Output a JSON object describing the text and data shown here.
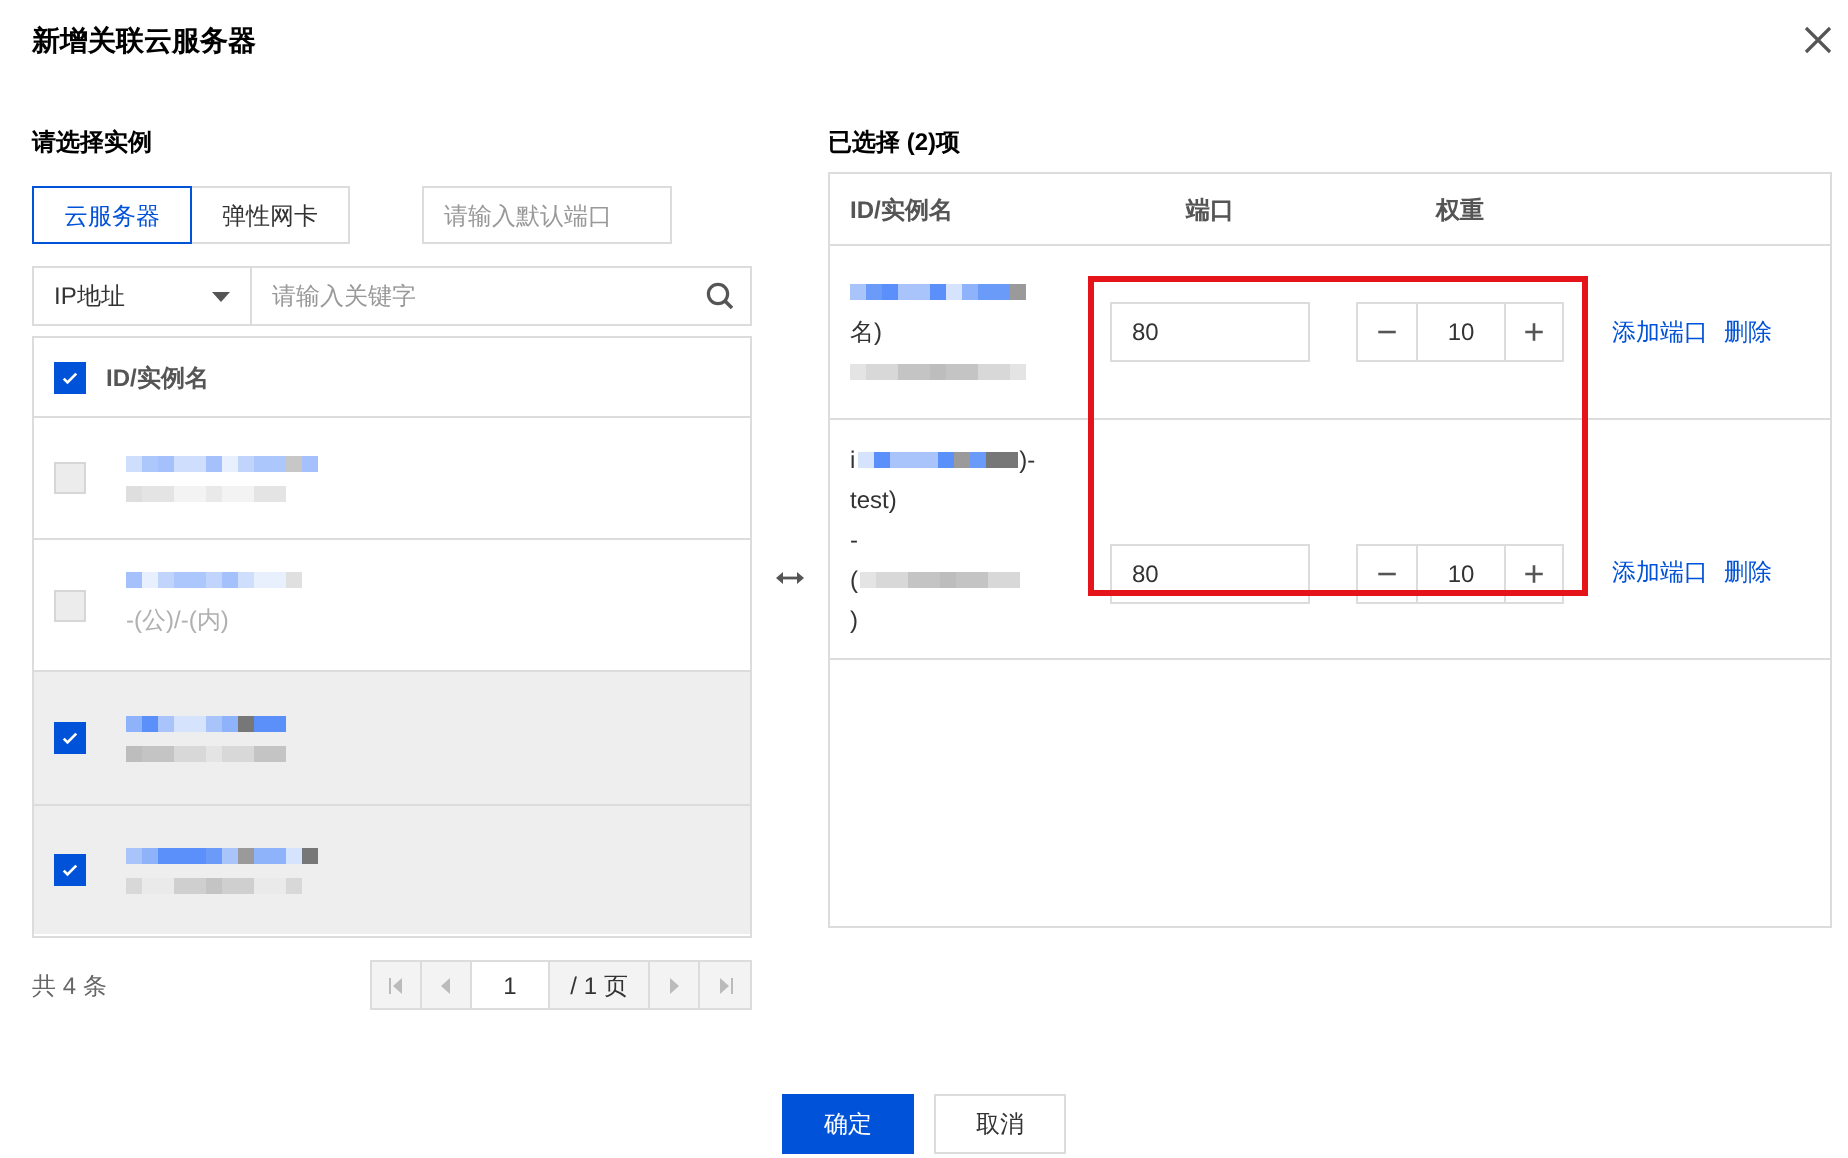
{
  "dialog": {
    "title": "新增关联云服务器"
  },
  "left": {
    "heading": "请选择实例",
    "tabs": [
      {
        "label": "云服务器",
        "selected": true
      },
      {
        "label": "弹性网卡",
        "selected": false
      }
    ],
    "port_field": {
      "placeholder": "请输入默认端口"
    },
    "filter_select": {
      "value": "IP地址"
    },
    "search": {
      "placeholder": "请输入关键字"
    },
    "table": {
      "header": "ID/实例名",
      "header_checked": true,
      "rows": [
        {
          "disabled": true,
          "checked": false
        },
        {
          "disabled": true,
          "checked": false,
          "line_2": "-(公)/-(内)"
        },
        {
          "disabled": false,
          "checked": true
        },
        {
          "disabled": false,
          "checked": true
        }
      ]
    },
    "total": "共 4 条",
    "pager": {
      "page": "1",
      "pages": "/ 1 页"
    }
  },
  "right": {
    "heading": "已选择 (2)项",
    "columns": [
      "ID/实例名",
      "端口",
      "权重"
    ],
    "rows": [
      {
        "lines": [
          {
            "kind": "redacted"
          },
          {
            "kind": "text",
            "text": "名)"
          },
          {
            "kind": "redacted"
          }
        ],
        "port": "80",
        "weight": "10",
        "decrement": "−",
        "increment": "+",
        "actions": [
          "添加端口",
          "删除"
        ]
      },
      {
        "lines": [
          {
            "kind": "redacted",
            "before": "i",
            "after": ")-"
          },
          {
            "kind": "text",
            "text": "test)"
          },
          {
            "kind": "text",
            "text": "-"
          },
          {
            "kind": "redacted",
            "before": "("
          },
          {
            "kind": "text",
            "text": ")"
          }
        ],
        "port": "80",
        "weight": "10",
        "decrement": "−",
        "increment": "+",
        "actions": [
          "添加端口",
          "删除"
        ]
      }
    ]
  },
  "buttons": [
    {
      "label": "确定",
      "kind": "primary"
    },
    {
      "label": "取消",
      "kind": "secondary"
    }
  ]
}
